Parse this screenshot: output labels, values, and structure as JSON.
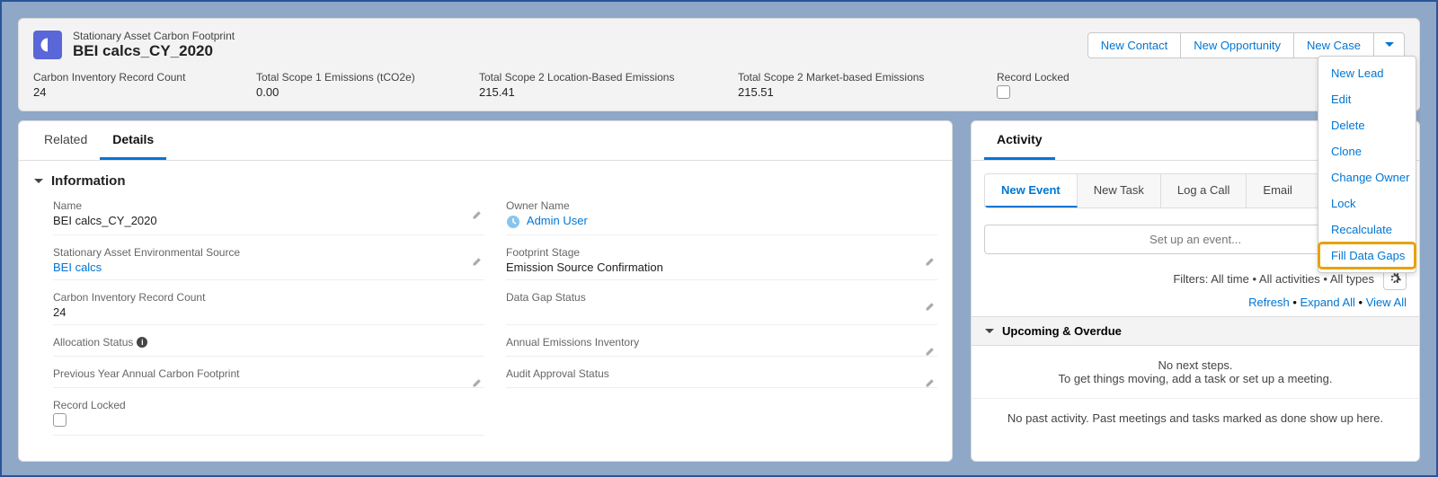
{
  "header": {
    "object_type": "Stationary Asset Carbon Footprint",
    "record_name": "BEI calcs_CY_2020",
    "actions": {
      "new_contact": "New Contact",
      "new_opportunity": "New Opportunity",
      "new_case": "New Case"
    },
    "dropdown": [
      "New Lead",
      "Edit",
      "Delete",
      "Clone",
      "Change Owner",
      "Lock",
      "Recalculate",
      "Fill Data Gaps"
    ],
    "dropdown_highlight": "Fill Data Gaps"
  },
  "stats": {
    "count_label": "Carbon Inventory Record Count",
    "count_val": "24",
    "scope1_label": "Total Scope 1 Emissions (tCO2e)",
    "scope1_val": "0.00",
    "scope2loc_label": "Total Scope 2 Location-Based Emissions",
    "scope2loc_val": "215.41",
    "scope2mkt_label": "Total Scope 2 Market-based Emissions",
    "scope2mkt_val": "215.51",
    "locked_label": "Record Locked"
  },
  "tabs": {
    "related": "Related",
    "details": "Details"
  },
  "section_info": "Information",
  "fields": {
    "name_label": "Name",
    "name_val": "BEI calcs_CY_2020",
    "owner_label": "Owner Name",
    "owner_val": "Admin User",
    "source_label": "Stationary Asset Environmental Source",
    "source_val": "BEI calcs",
    "stage_label": "Footprint Stage",
    "stage_val": "Emission Source Confirmation",
    "count_label": "Carbon Inventory Record Count",
    "count_val": "24",
    "gap_label": "Data Gap Status",
    "gap_val": "",
    "alloc_label": "Allocation Status",
    "alloc_val": "",
    "annual_label": "Annual Emissions Inventory",
    "annual_val": "",
    "prev_label": "Previous Year Annual Carbon Footprint",
    "prev_val": "",
    "audit_label": "Audit Approval Status",
    "audit_val": "",
    "locked_label": "Record Locked"
  },
  "activity": {
    "heading": "Activity",
    "tabs": {
      "new_event": "New Event",
      "new_task": "New Task",
      "log_call": "Log a Call",
      "email": "Email"
    },
    "setup_placeholder": "Set up an event...",
    "filters": "Filters: All time • All activities • All types",
    "refresh": "Refresh",
    "expand": "Expand All",
    "view_all": "View All",
    "upcoming": "Upcoming & Overdue",
    "no_next": "No next steps.",
    "no_next_sub": "To get things moving, add a task or set up a meeting.",
    "no_past": "No past activity. Past meetings and tasks marked as done show up here."
  }
}
